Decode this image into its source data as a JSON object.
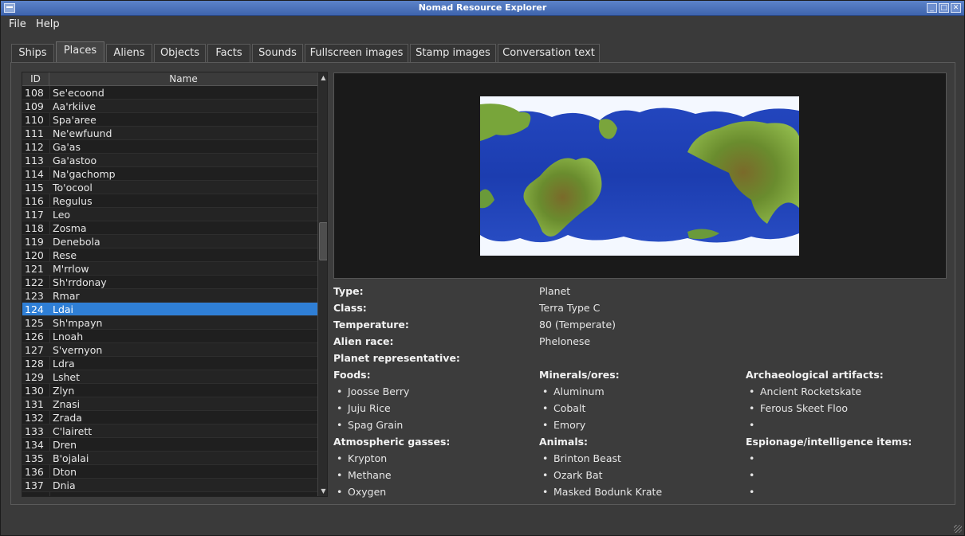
{
  "window": {
    "title": "Nomad Resource Explorer"
  },
  "menu": [
    "File",
    "Help"
  ],
  "tabs": [
    "Ships",
    "Places",
    "Aliens",
    "Objects",
    "Facts",
    "Sounds",
    "Fullscreen images",
    "Stamp images",
    "Conversation text"
  ],
  "active_tab": "Places",
  "list": {
    "headers": {
      "id": "ID",
      "name": "Name"
    },
    "rows": [
      [
        "108",
        "Se'ecoond"
      ],
      [
        "109",
        "Aa'rkiive"
      ],
      [
        "110",
        "Spa'aree"
      ],
      [
        "111",
        "Ne'ewfuund"
      ],
      [
        "112",
        "Ga'as"
      ],
      [
        "113",
        "Ga'astoo"
      ],
      [
        "114",
        "Na'gachomp"
      ],
      [
        "115",
        "To'ocool"
      ],
      [
        "116",
        "Regulus"
      ],
      [
        "117",
        "Leo"
      ],
      [
        "118",
        "Zosma"
      ],
      [
        "119",
        "Denebola"
      ],
      [
        "120",
        "Rese"
      ],
      [
        "121",
        "M'rrlow"
      ],
      [
        "122",
        "Sh'rrdonay"
      ],
      [
        "123",
        "Rmar"
      ],
      [
        "124",
        "Ldai"
      ],
      [
        "125",
        "Sh'mpayn"
      ],
      [
        "126",
        "Lnoah"
      ],
      [
        "127",
        "S'vernyon"
      ],
      [
        "128",
        "Ldra"
      ],
      [
        "129",
        "Lshet"
      ],
      [
        "130",
        "Zlyn"
      ],
      [
        "131",
        "Znasi"
      ],
      [
        "132",
        "Zrada"
      ],
      [
        "133",
        "C'lairett"
      ],
      [
        "134",
        "Dren"
      ],
      [
        "135",
        "B'ojalai"
      ],
      [
        "136",
        "Dton"
      ],
      [
        "137",
        "Dnia"
      ]
    ],
    "selected_id": "124"
  },
  "details": {
    "type_label": "Type:",
    "type_value": "Planet",
    "class_label": "Class:",
    "class_value": "Terra Type C",
    "temp_label": "Temperature:",
    "temp_value": "80 (Temperate)",
    "race_label": "Alien race:",
    "race_value": "Phelonese",
    "rep_label": "Planet representative:",
    "rep_value": "",
    "foods_label": "Foods:",
    "foods": [
      "Joosse Berry",
      "Juju Rice",
      "Spag Grain"
    ],
    "minerals_label": "Minerals/ores:",
    "minerals": [
      "Aluminum",
      "Cobalt",
      "Emory"
    ],
    "artifacts_label": "Archaeological artifacts:",
    "artifacts": [
      "Ancient Rocketskate",
      "Ferous Skeet Floo",
      ""
    ],
    "gasses_label": "Atmospheric gasses:",
    "gasses": [
      "Krypton",
      "Methane",
      "Oxygen"
    ],
    "animals_label": "Animals:",
    "animals": [
      "Brinton Beast",
      "Ozark Bat",
      "Masked Bodunk Krate"
    ],
    "espionage_label": "Espionage/intelligence items:",
    "espionage": [
      "",
      "",
      ""
    ]
  },
  "colors": {
    "ocean": "#1d3fb5",
    "land": "#5f8a2c",
    "ice": "#ffffff",
    "selection": "#2f7fd6"
  }
}
